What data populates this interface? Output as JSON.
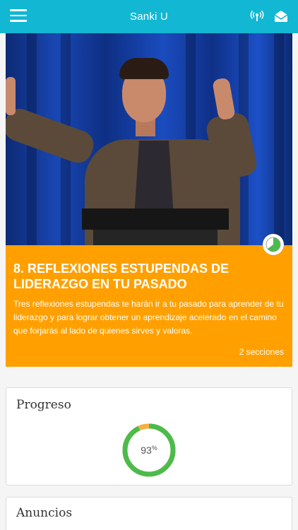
{
  "header": {
    "title": "Sanki U",
    "menu_icon": "hamburger-menu-icon",
    "signal_icon": "broadcast-icon",
    "mail_icon": "open-envelope-icon",
    "bar_color": "#12b7d3"
  },
  "course": {
    "title": "8. REFLEXIONES ESTUPENDAS DE LIDERAZGO EN TU PASADO",
    "description": "Tres reflexiones estupendas te harán ir a tu pasado para aprender de tu liderazgo y para lograr obtener un aprendizaje acelerado en el camino que forjarás al lado de quienes sirves y valoras.",
    "sections": "2 secciones",
    "card_color": "#ffa000",
    "badge_icon": "progress-pie-icon"
  },
  "progress": {
    "label": "Progreso",
    "value": "93",
    "unit": "%",
    "percent": 93,
    "ring_color": "#4cbb4c",
    "remaining_color": "#f5b041"
  },
  "announcements": {
    "label": "Anuncios"
  }
}
